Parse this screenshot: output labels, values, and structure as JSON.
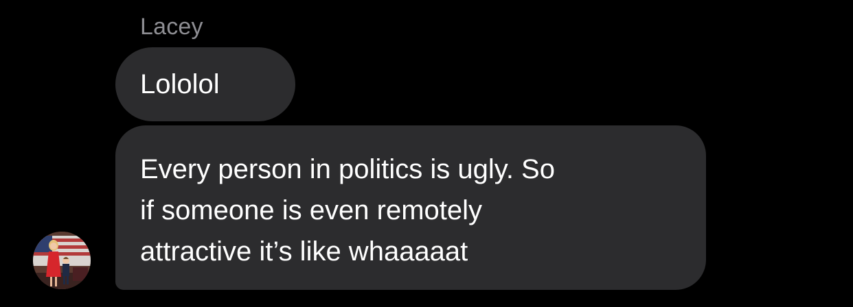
{
  "conversation": {
    "sender_name": "Lacey",
    "messages": [
      {
        "text": "Lololol"
      },
      {
        "lines": [
          "Every person in politics is ugly. So",
          "if someone is even remotely",
          "attractive it’s like whaaaaat"
        ]
      }
    ]
  },
  "avatar": {
    "icon": "contact-photo"
  },
  "colors": {
    "background": "#000000",
    "bubble": "#2c2c2e",
    "message_text": "#ffffff",
    "sender_name": "#8e8e93"
  }
}
